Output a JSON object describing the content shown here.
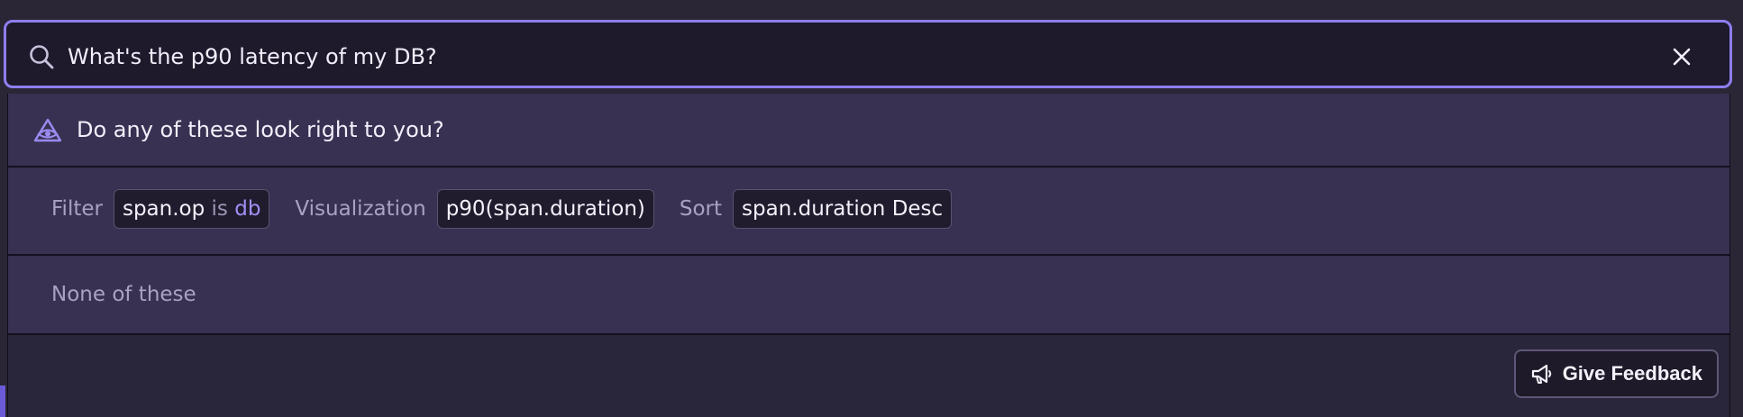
{
  "search": {
    "query": "What's the p90 latency of my DB?",
    "icon": "search-icon",
    "clear_icon": "close-icon"
  },
  "assistant": {
    "prompt": "Do any of these look right to you?",
    "icon": "eye-icon"
  },
  "suggestion": {
    "filter_label": "Filter",
    "filter_key": "span.op",
    "filter_op": "is",
    "filter_value": "db",
    "visualization_label": "Visualization",
    "visualization_value": "p90(span.duration)",
    "sort_label": "Sort",
    "sort_value": "span.duration Desc"
  },
  "none_option": "None of these",
  "feedback": {
    "label": "Give Feedback",
    "icon": "megaphone-icon"
  },
  "colors": {
    "accent": "#8f7ef0",
    "row_bg": "#383152",
    "page_bg": "#2a2636",
    "value_highlight": "#a28ff5"
  }
}
